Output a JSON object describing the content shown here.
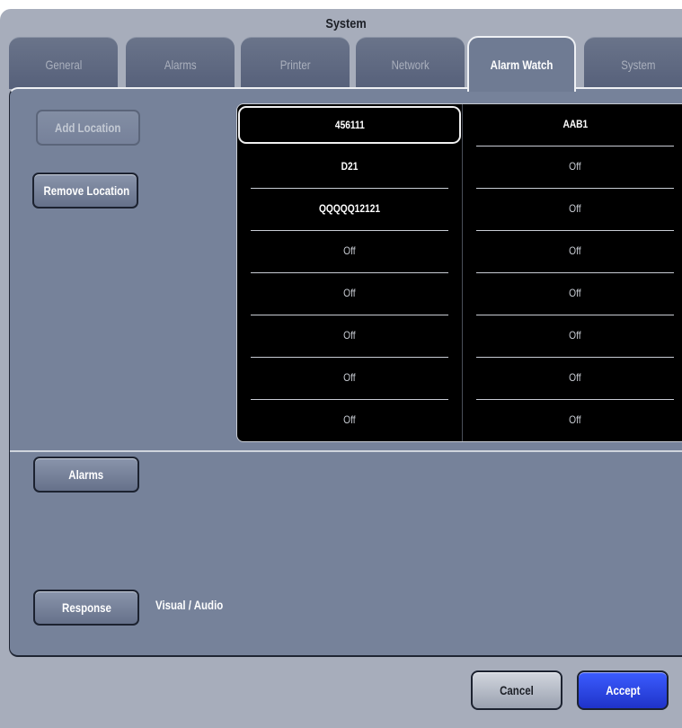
{
  "window": {
    "title": "System"
  },
  "tabs": [
    {
      "label": "General",
      "active": false
    },
    {
      "label": "Alarms",
      "active": false
    },
    {
      "label": "Printer",
      "active": false
    },
    {
      "label": "Network",
      "active": false
    },
    {
      "label": "Alarm Watch",
      "active": true
    },
    {
      "label": "System",
      "active": false
    }
  ],
  "actions": {
    "add_location": "Add Location",
    "remove_location": "Remove Location",
    "alarms": "Alarms",
    "response": "Response",
    "response_value": "Visual / Audio"
  },
  "locations": {
    "left": [
      "456111",
      "D21",
      "QQQQQ12121",
      "Off",
      "Off",
      "Off",
      "Off",
      "Off"
    ],
    "right": [
      "AAB1",
      "Off",
      "Off",
      "Off",
      "Off",
      "Off",
      "Off",
      "Off"
    ],
    "selected_index": 0
  },
  "footer": {
    "cancel": "Cancel",
    "accept": "Accept"
  },
  "colors": {
    "accent": "#2a45e6",
    "panel": "#76829a",
    "grid_bg": "#000000"
  }
}
